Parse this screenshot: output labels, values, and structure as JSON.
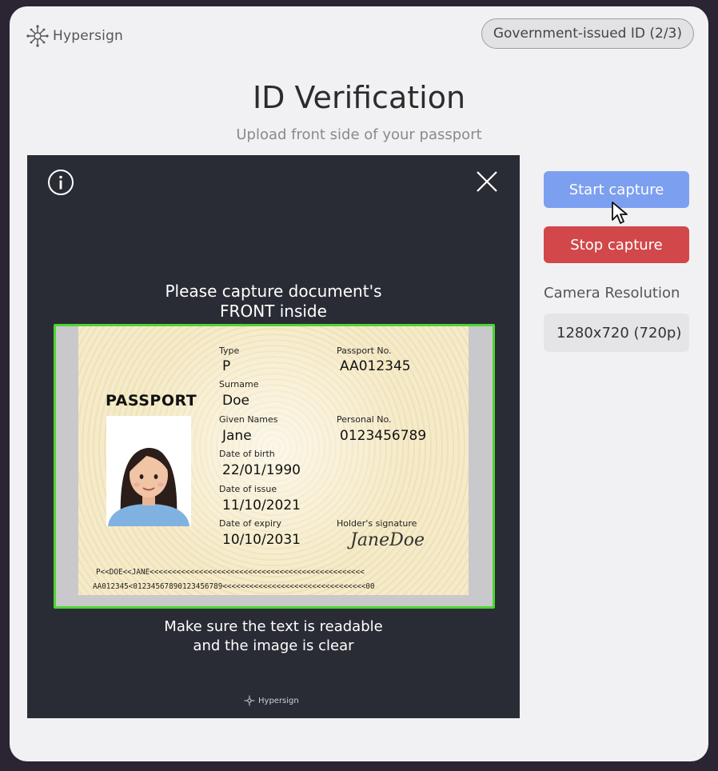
{
  "brand": {
    "name": "Hypersign",
    "footer_name": "Hypersign"
  },
  "header": {
    "step_badge": "Government-issued ID (2/3)",
    "title": "ID Verification",
    "subtitle": "Upload front side of your passport"
  },
  "camera": {
    "instruction_top_1": "Please capture document's",
    "instruction_top_2": "FRONT inside",
    "instruction_bottom_1": "Make sure the text is readable",
    "instruction_bottom_2": "and the image is clear"
  },
  "passport": {
    "heading": "PASSPORT",
    "type_label": "Type",
    "type_value": "P",
    "surname_label": "Surname",
    "surname_value": "Doe",
    "given_label": "Given Names",
    "given_value": "Jane",
    "dob_label": "Date of birth",
    "dob_value": "22/01/1990",
    "issue_label": "Date of issue",
    "issue_value": "11/10/2021",
    "expiry_label": "Date of expiry",
    "expiry_value": "10/10/2031",
    "passport_no_label": "Passport No.",
    "passport_no_value": "AA012345",
    "personal_no_label": "Personal No.",
    "personal_no_value": "0123456789",
    "signature_label": "Holder's signature",
    "signature_value": "JaneDoe",
    "mrz_line1": "P<<DOE<<JANE<<<<<<<<<<<<<<<<<<<<<<<<<<<<<<<<<<<<<<<<<<<<<<<<",
    "mrz_line2": "AA012345<01234567890123456789<<<<<<<<<<<<<<<<<<<<<<<<<<<<<<<<00"
  },
  "controls": {
    "start_label": "Start capture",
    "stop_label": "Stop capture",
    "resolution_label": "Camera Resolution",
    "resolution_value": "1280x720 (720p)"
  },
  "colors": {
    "start": "#7c9ff0",
    "stop": "#d2474a",
    "frame": "#4cd632",
    "camera_bg": "#2a2c35"
  }
}
